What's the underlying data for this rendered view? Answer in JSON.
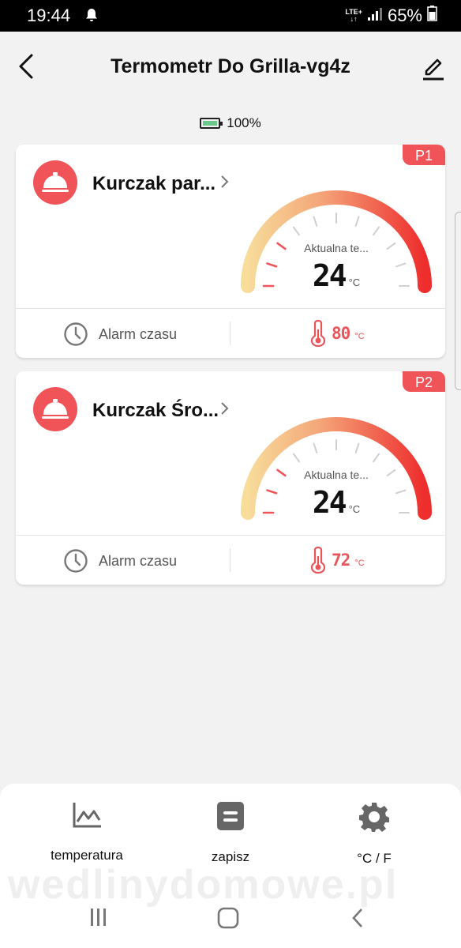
{
  "status_bar": {
    "time": "19:44",
    "network": "LTE+",
    "battery": "65%"
  },
  "header": {
    "title": "Termometr Do Grilla-vg4z"
  },
  "device_battery": "100%",
  "probes": [
    {
      "tag": "P1",
      "name": "Kurczak par...",
      "gauge_label": "Aktualna te...",
      "current_temp": "24",
      "unit": "°C",
      "alarm_label": "Alarm czasu",
      "target_temp": "80",
      "target_unit": "°C"
    },
    {
      "tag": "P2",
      "name": "Kurczak Śro...",
      "gauge_label": "Aktualna te...",
      "current_temp": "24",
      "unit": "°C",
      "alarm_label": "Alarm czasu",
      "target_temp": "72",
      "target_unit": "°C"
    }
  ],
  "bottom_nav": [
    {
      "label": "temperatura",
      "icon": "chart-line-icon"
    },
    {
      "label": "zapisz",
      "icon": "document-icon"
    },
    {
      "label": "°C / F",
      "icon": "gear-icon"
    }
  ],
  "watermark": "wedlinydomowe.pl",
  "colors": {
    "accent": "#f05358",
    "gauge_start": "#f7dc9a",
    "gauge_end": "#ee2d2d"
  }
}
